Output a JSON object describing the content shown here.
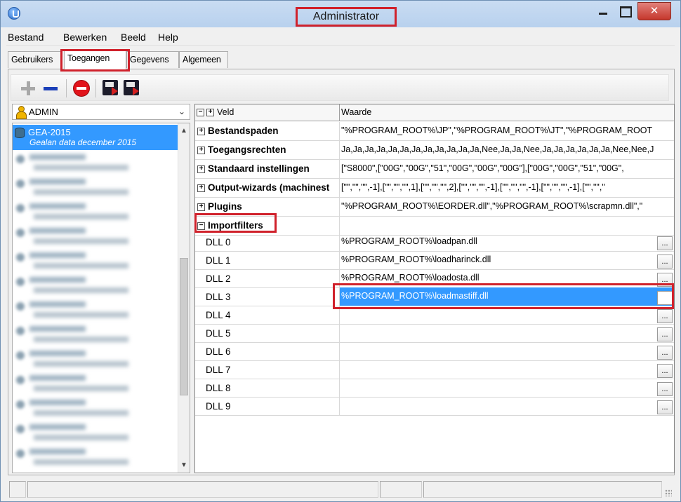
{
  "window": {
    "title": "Administrator",
    "close_glyph": "✕",
    "icons": {
      "app": "app-icon",
      "minimize": "minimize-icon",
      "maximize": "maximize-icon",
      "close": "close-icon"
    }
  },
  "menubar": {
    "items": [
      "Bestand",
      "Bewerken",
      "Beeld",
      "Help"
    ]
  },
  "tabs": {
    "items": [
      "Gebruikers",
      "Toegangen",
      "Gegevens",
      "Algemeen"
    ],
    "active": "Toegangen"
  },
  "toolbar": {
    "buttons": [
      "add-icon",
      "remove-icon",
      "stop-icon",
      "save-icon",
      "save-as-icon"
    ]
  },
  "left": {
    "user_select": {
      "value": "ADMIN",
      "arrow": "⌄"
    },
    "scroll_up": "▲",
    "scroll_down": "▼",
    "selected_item": {
      "name": "GEA-2015",
      "description": "Gealan data december 2015"
    }
  },
  "grid": {
    "headers": {
      "col1": "Veld",
      "col2": "Waarde"
    },
    "expand_glyph": "+",
    "collapse_glyph": "−",
    "ellipsis": "...",
    "categories": [
      {
        "label": "Bestandspaden",
        "value": "\"%PROGRAM_ROOT%\\JP\",\"%PROGRAM_ROOT%\\JT\",\"%PROGRAM_ROOT"
      },
      {
        "label": "Toegangsrechten",
        "value": "Ja,Ja,Ja,Ja,Ja,Ja,Ja,Ja,Ja,Ja,Ja,Ja,Nee,Ja,Ja,Nee,Ja,Ja,Ja,Ja,Ja,Ja,Nee,Nee,J"
      },
      {
        "label": "Standaard instellingen",
        "value": "[\"S8000\",[\"00G\",\"00G\",\"51\",\"00G\",\"00G\",\"00G\"],[\"00G\",\"00G\",\"51\",\"00G\","
      },
      {
        "label": "Output-wizards (machinest",
        "value": "[\"\",\"\",\"\",-1],[\"\",\"\",\"\",1],[\"\",\"\",\"\",2],[\"\",\"\",\"\",-1],[\"\",\"\",\"\",-1],[\"\",\"\",\"\",-1],[\"\",\"\",\""
      },
      {
        "label": "Plugins",
        "value": "\"%PROGRAM_ROOT%\\EORDER.dll\",\"%PROGRAM_ROOT%\\scrapmn.dll\",\""
      },
      {
        "label": "Importfilters",
        "value": ""
      }
    ],
    "dll_rows": [
      {
        "label": "DLL 0",
        "value": "%PROGRAM_ROOT%\\loadpan.dll"
      },
      {
        "label": "DLL 1",
        "value": "%PROGRAM_ROOT%\\loadharinck.dll"
      },
      {
        "label": "DLL 2",
        "value": "%PROGRAM_ROOT%\\loadosta.dll"
      },
      {
        "label": "DLL 3",
        "value": "%PROGRAM_ROOT%\\loadmastiff.dll"
      },
      {
        "label": "DLL 4",
        "value": ""
      },
      {
        "label": "DLL 5",
        "value": ""
      },
      {
        "label": "DLL 6",
        "value": ""
      },
      {
        "label": "DLL 7",
        "value": ""
      },
      {
        "label": "DLL 8",
        "value": ""
      },
      {
        "label": "DLL 9",
        "value": ""
      }
    ],
    "selected_row": "DLL 3"
  },
  "colors": {
    "highlight_red": "#d0212b",
    "selection_blue": "#3399ff"
  }
}
